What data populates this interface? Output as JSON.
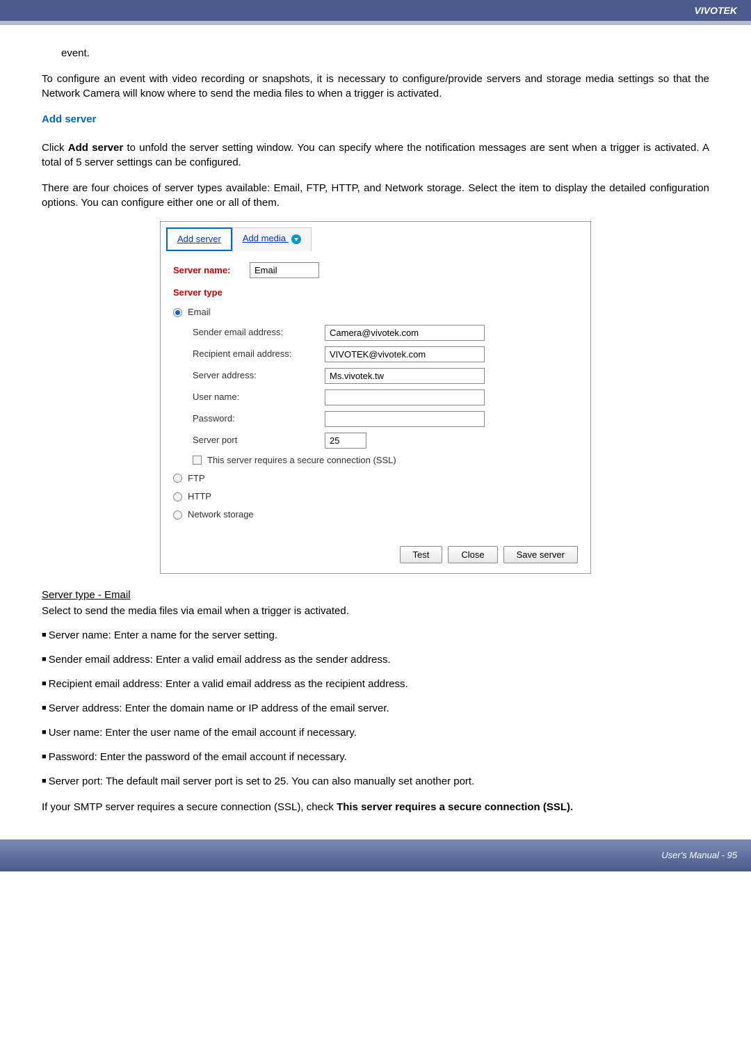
{
  "header": {
    "brand": "VIVOTEK"
  },
  "intro": {
    "event_line": "event.",
    "para1": "To configure an event with video recording or snapshots, it is necessary to configure/provide servers and storage media settings so that the Network Camera will know where to send the media files to when a trigger is activated."
  },
  "section": {
    "title": "Add server",
    "para2": "Click Add server to unfold the server setting window. You can specify where the notification messages are sent when a trigger is activated. A total of 5 server settings can be configured.",
    "para3": "There are four choices of server types available: Email, FTP, HTTP, and Network storage. Select the item to display the detailed configuration options. You can configure either one or all of them."
  },
  "panel": {
    "tabs": {
      "add_server": "Add server",
      "add_media": "Add media"
    },
    "server_name_label": "Server name:",
    "server_name_value": "Email",
    "server_type_label": "Server type",
    "radios": {
      "email": "Email",
      "ftp": "FTP",
      "http": "HTTP",
      "network": "Network storage"
    },
    "fields": {
      "sender_label": "Sender email address:",
      "sender_value": "Camera@vivotek.com",
      "recipient_label": "Recipient email address:",
      "recipient_value": "VIVOTEK@vivotek.com",
      "server_addr_label": "Server address:",
      "server_addr_value": "Ms.vivotek.tw",
      "user_label": "User name:",
      "user_value": "",
      "pass_label": "Password:",
      "pass_value": "",
      "port_label": "Server port",
      "port_value": "25",
      "ssl_label": "This server requires a secure connection (SSL)"
    },
    "buttons": {
      "test": "Test",
      "close": "Close",
      "save": "Save server"
    }
  },
  "lower": {
    "heading": "Server type - Email",
    "heading_desc": "Select to send the media files via email when a trigger is activated.",
    "bullets": [
      "Server name: Enter a name for the server setting.",
      "Sender email address: Enter a valid email address as the sender address.",
      "Recipient email address: Enter a valid email address as the recipient address.",
      "Server address: Enter the domain name or IP address of the email server.",
      "User name: Enter the user name of the email account if necessary.",
      "Password: Enter the password of the email account if necessary.",
      "Server port: The default mail server port is set to 25. You can also manually set another port."
    ],
    "ssl_note": "If your SMTP server requires a secure connection (SSL), check This server requires a secure connection (SSL)."
  },
  "footer": {
    "text": "User's Manual - 95"
  }
}
